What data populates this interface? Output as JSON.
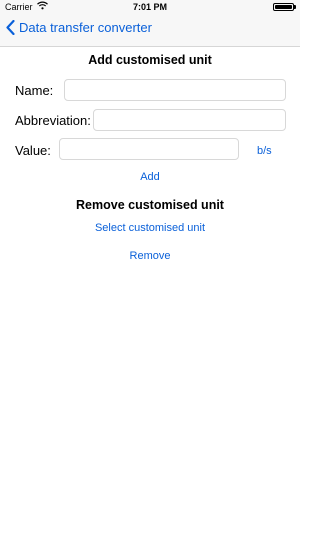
{
  "status_bar": {
    "carrier": "Carrier",
    "time": "7:01 PM",
    "icons": [
      "wifi-icon",
      "battery-icon"
    ]
  },
  "nav": {
    "back_label": "Data transfer converter",
    "back_icon": "chevron-left-icon",
    "accent_color": "#0a60d9"
  },
  "add_section": {
    "title": "Add customised unit",
    "name_label": "Name:",
    "name_value": "",
    "abbreviation_label": "Abbreviation:",
    "abbreviation_value": "",
    "value_label": "Value:",
    "value_value": "",
    "unit_button": "b/s",
    "add_button": "Add"
  },
  "remove_section": {
    "title": "Remove customised unit",
    "select_button": "Select customised unit",
    "remove_button": "Remove"
  }
}
